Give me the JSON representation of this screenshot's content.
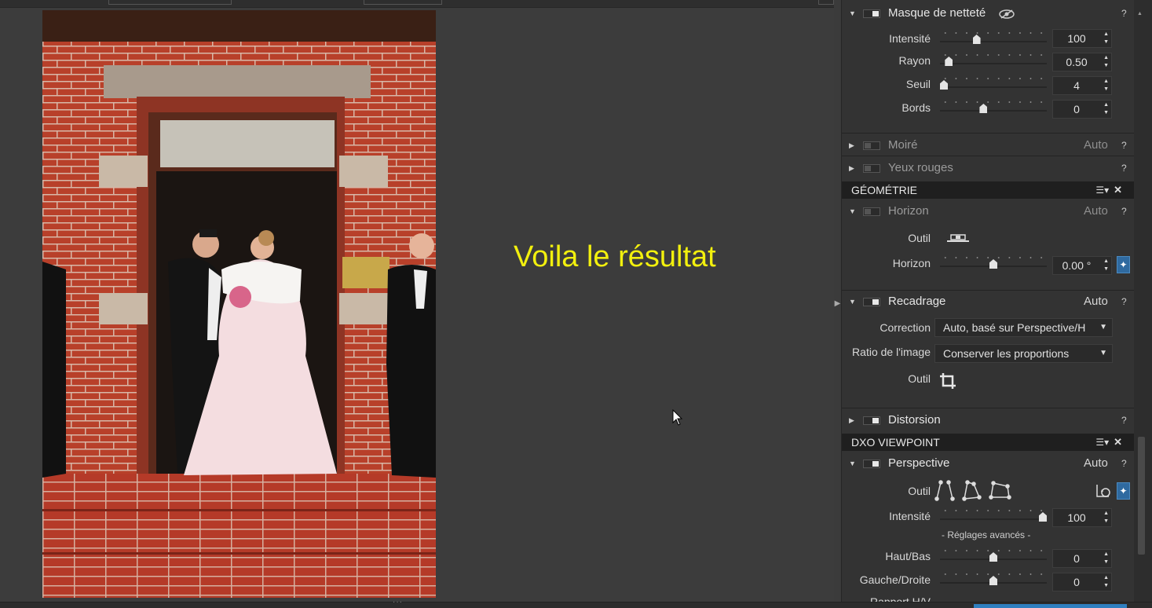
{
  "viewer": {
    "overlay_text": "Voila le résultat"
  },
  "panel": {
    "masque": {
      "title": "Masque de netteté",
      "help": "?",
      "rows": [
        {
          "label": "Intensité",
          "value": "100",
          "pos": 0.33
        },
        {
          "label": "Rayon",
          "value": "0.50",
          "pos": 0.05
        },
        {
          "label": "Seuil",
          "value": "4",
          "pos": 0.0
        },
        {
          "label": "Bords",
          "value": "0",
          "pos": 0.4
        }
      ]
    },
    "moire": {
      "title": "Moiré",
      "auto": "Auto",
      "help": "?"
    },
    "yeux": {
      "title": "Yeux rouges",
      "help": "?"
    },
    "geometrie": {
      "title": "GÉOMÉTRIE",
      "menu": "☰▾",
      "close": "✕"
    },
    "horizon": {
      "title": "Horizon",
      "auto": "Auto",
      "help": "?",
      "tool_label": "Outil",
      "slider_label": "Horizon",
      "value": "0.00 °",
      "pos": 0.5
    },
    "recadrage": {
      "title": "Recadrage",
      "auto": "Auto",
      "help": "?",
      "correction_label": "Correction",
      "correction_value": "Auto, basé sur Perspective/H",
      "ratio_label": "Ratio de l'image",
      "ratio_value": "Conserver les proportions",
      "tool_label": "Outil"
    },
    "distorsion": {
      "title": "Distorsion",
      "help": "?"
    },
    "viewpoint": {
      "title": "DXO VIEWPOINT",
      "menu": "☰▾",
      "close": "✕"
    },
    "perspective": {
      "title": "Perspective",
      "auto": "Auto",
      "help": "?",
      "tool_label": "Outil",
      "intensite_label": "Intensité",
      "intensite_value": "100",
      "intensite_pos": 1.0,
      "advanced": "- Réglages avancés -",
      "rows": [
        {
          "label": "Haut/Bas",
          "value": "0",
          "pos": 0.5
        },
        {
          "label": "Gauche/Droite",
          "value": "0",
          "pos": 0.5
        }
      ],
      "partial_label": "Rapport H/V"
    }
  }
}
